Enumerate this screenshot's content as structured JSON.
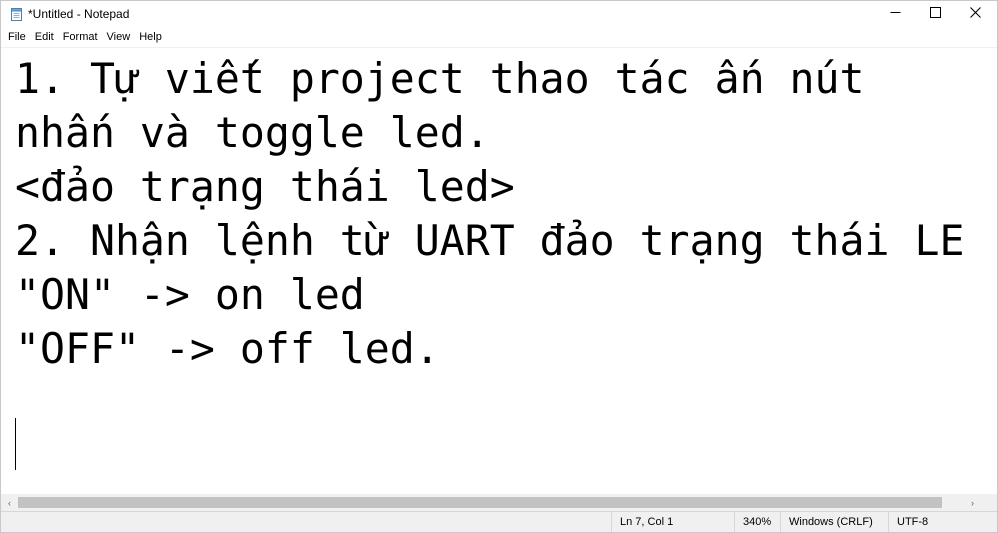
{
  "window": {
    "title": "*Untitled - Notepad",
    "icons": {
      "app": "notepad-icon",
      "minimize": "minimize-icon",
      "maximize": "maximize-icon",
      "close": "close-icon"
    }
  },
  "menu": {
    "items": [
      "File",
      "Edit",
      "Format",
      "View",
      "Help"
    ]
  },
  "editor": {
    "content": "1. Tự viết project thao tác ấn nút\nnhấn và toggle led.\n<đảo trạng thái led>\n2. Nhận lệnh từ UART đảo trạng thái LE\n\"ON\" -> on led\n\"OFF\" -> off led.\n"
  },
  "scrollbar": {
    "left_arrow": "‹",
    "right_arrow": "›"
  },
  "status": {
    "position": "Ln 7, Col 1",
    "zoom": "340%",
    "line_ending": "Windows (CRLF)",
    "encoding": "UTF-8"
  },
  "colors": {
    "background": "#ffffff",
    "chrome": "#f0f0f0",
    "scroll_thumb": "#c2c2c2",
    "text": "#000000"
  }
}
